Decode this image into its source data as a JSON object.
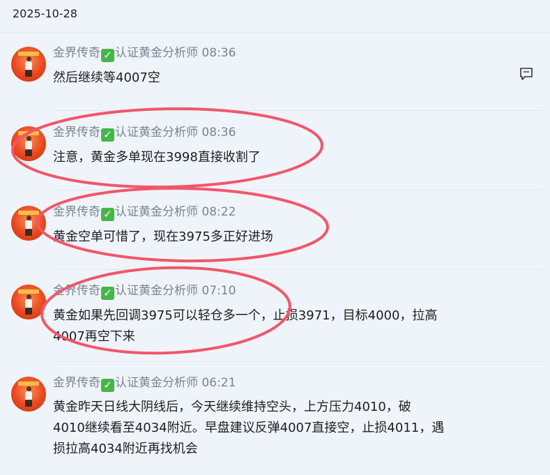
{
  "date_header": "2025-10-28",
  "author": {
    "name": "金界传奇",
    "verified_badge": "✅",
    "title": "认证黄金分析师"
  },
  "messages": [
    {
      "time": "08:36",
      "lines": [
        "然后继续等4007空"
      ]
    },
    {
      "time": "08:36",
      "lines": [
        "注意，黄金多单现在3998直接收割了"
      ]
    },
    {
      "time": "08:22",
      "lines": [
        "黄金空单可惜了，现在3975多正好进场"
      ]
    },
    {
      "time": "07:10",
      "lines": [
        "黄金如果先回调3975可以轻仓多一个，止损3971，目标4000，拉高",
        "4007再空下来"
      ]
    },
    {
      "time": "06:21",
      "lines": [
        "黄金昨天日线大阴线后，今天继续维持空头，上方压力4010，破",
        "4010继续看至4034附近。早盘建议反弹4007直接空，止损4011，遇",
        "损拉高4034附近再找机会"
      ]
    }
  ],
  "icons": {
    "comment": "comment-icon",
    "avatar": "avatar-image"
  },
  "colors": {
    "annotation": "#f2566b",
    "background": "#eef4f9",
    "meta_text": "#7b8490"
  }
}
